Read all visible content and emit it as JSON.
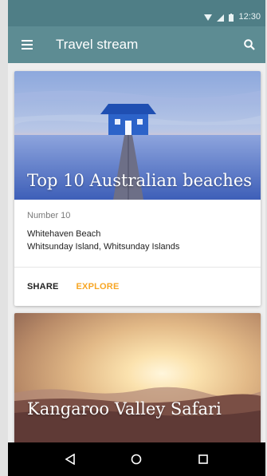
{
  "status_bar": {
    "time": "12:30"
  },
  "app_bar": {
    "title": "Travel stream",
    "menu_icon": "menu-icon",
    "search_icon": "search-icon"
  },
  "cards": [
    {
      "title": "Top 10 Australian beaches",
      "subhead": "Number 10",
      "line1": "Whitehaven Beach",
      "line2": "Whitsunday Island, Whitsunday Islands",
      "actions": {
        "share": "SHARE",
        "explore": "EXPLORE"
      }
    },
    {
      "title": "Kangaroo Valley Safari"
    }
  ],
  "colors": {
    "status_bar": "#4f7e86",
    "app_bar": "#5d8c93",
    "accent": "#f7a624",
    "nav_bar": "#000000"
  },
  "nav": {
    "back_icon": "back-icon",
    "home_icon": "home-icon",
    "recents_icon": "recents-icon"
  }
}
